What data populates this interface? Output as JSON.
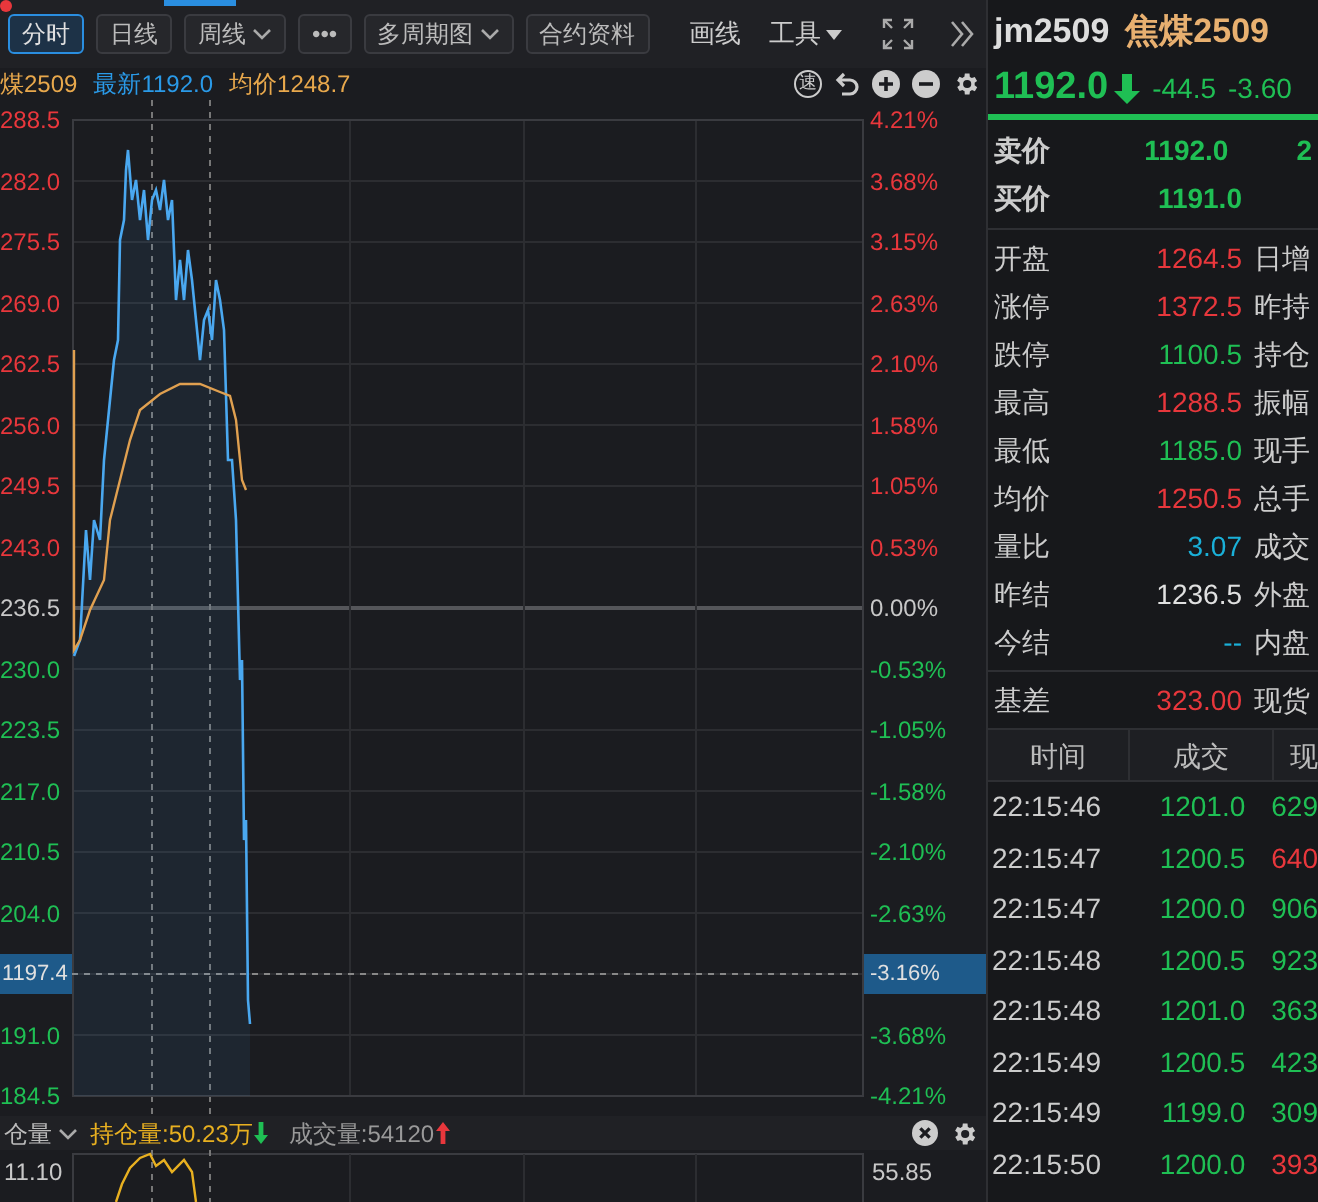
{
  "toolbar": {
    "buttons": [
      {
        "label": "分时",
        "selected": true,
        "dropdown": false
      },
      {
        "label": "日线",
        "selected": false,
        "dropdown": false
      },
      {
        "label": "周线",
        "selected": false,
        "dropdown": true
      },
      {
        "label": "•••",
        "selected": false,
        "dropdown": false
      },
      {
        "label": "多周期图",
        "selected": false,
        "dropdown": true
      },
      {
        "label": "合约资料",
        "selected": false,
        "dropdown": false
      }
    ],
    "actions": [
      {
        "label": "画线",
        "dropdown": false
      },
      {
        "label": "工具",
        "dropdown": true
      }
    ]
  },
  "info_bar": {
    "symbol": "煤2509",
    "latest": "最新1192.0",
    "average": "均价1248.7",
    "badge": "速"
  },
  "chart": {
    "price_axis": [
      {
        "text": "288.5",
        "kind": "tick",
        "color": "#e8373c"
      },
      {
        "text": "282.0",
        "kind": "tick",
        "color": "#e8373c"
      },
      {
        "text": "275.5",
        "kind": "tick",
        "color": "#e8373c"
      },
      {
        "text": "269.0",
        "kind": "tick",
        "color": "#e8373c"
      },
      {
        "text": "262.5",
        "kind": "tick",
        "color": "#e8373c"
      },
      {
        "text": "256.0",
        "kind": "tick",
        "color": "#e8373c"
      },
      {
        "text": "249.5",
        "kind": "tick",
        "color": "#e8373c"
      },
      {
        "text": "243.0",
        "kind": "tick",
        "color": "#e8373c"
      },
      {
        "text": "236.5",
        "kind": "tick",
        "color": "#c8c8c8"
      },
      {
        "text": "230.0",
        "kind": "tick",
        "color": "#1fbf54"
      },
      {
        "text": "223.5",
        "kind": "tick",
        "color": "#1fbf54"
      },
      {
        "text": "217.0",
        "kind": "tick",
        "color": "#1fbf54"
      },
      {
        "text": "210.5",
        "kind": "tick",
        "color": "#1fbf54"
      },
      {
        "text": "204.0",
        "kind": "tick",
        "color": "#1fbf54"
      },
      {
        "text": "1197.4",
        "kind": "cursor"
      },
      {
        "text": "191.0",
        "kind": "tick",
        "color": "#1fbf54"
      },
      {
        "text": "184.5",
        "kind": "tick",
        "color": "#1fbf54"
      }
    ],
    "percent_axis": [
      {
        "text": "4.21%",
        "kind": "tick",
        "color": "#e8373c"
      },
      {
        "text": "3.68%",
        "kind": "tick",
        "color": "#e8373c"
      },
      {
        "text": "3.15%",
        "kind": "tick",
        "color": "#e8373c"
      },
      {
        "text": "2.63%",
        "kind": "tick",
        "color": "#e8373c"
      },
      {
        "text": "2.10%",
        "kind": "tick",
        "color": "#e8373c"
      },
      {
        "text": "1.58%",
        "kind": "tick",
        "color": "#e8373c"
      },
      {
        "text": "1.05%",
        "kind": "tick",
        "color": "#e8373c"
      },
      {
        "text": "0.53%",
        "kind": "tick",
        "color": "#e8373c"
      },
      {
        "text": "0.00%",
        "kind": "tick",
        "color": "#c8c8c8"
      },
      {
        "text": "-0.53%",
        "kind": "tick",
        "color": "#1fbf54"
      },
      {
        "text": "-1.05%",
        "kind": "tick",
        "color": "#1fbf54"
      },
      {
        "text": "-1.58%",
        "kind": "tick",
        "color": "#1fbf54"
      },
      {
        "text": "-2.10%",
        "kind": "tick",
        "color": "#1fbf54"
      },
      {
        "text": "-2.63%",
        "kind": "tick",
        "color": "#1fbf54"
      },
      {
        "text": "-3.16%",
        "kind": "cursor"
      },
      {
        "text": "-3.68%",
        "kind": "tick",
        "color": "#1fbf54"
      },
      {
        "text": "-4.21%",
        "kind": "tick",
        "color": "#1fbf54"
      }
    ]
  },
  "indicator_bar": {
    "selector": "仓量",
    "open_interest": "持仓量:50.23万",
    "oi_rising": false,
    "volume": "成交量:54120",
    "volume_rising": true
  },
  "sub_chart": {
    "left_value": "11.10",
    "right_value": "55.85"
  },
  "quote": {
    "code": "jm2509",
    "name": "焦煤2509",
    "price": "1192.0",
    "rising": false,
    "change": "-44.5",
    "change_pct": "-3.60",
    "bid_ask": [
      {
        "label": "卖价",
        "value": "1192.0",
        "extra": "2"
      },
      {
        "label": "买价",
        "value": "1191.0"
      }
    ],
    "stats": [
      {
        "label": "开盘",
        "value": "1264.5",
        "color": "#e8373c",
        "label2": "日增"
      },
      {
        "label": "涨停",
        "value": "1372.5",
        "color": "#e8373c",
        "label2": "昨持"
      },
      {
        "label": "跌停",
        "value": "1100.5",
        "color": "#1fbf54",
        "label2": "持仓"
      },
      {
        "label": "最高",
        "value": "1288.5",
        "color": "#e8373c",
        "label2": "振幅"
      },
      {
        "label": "最低",
        "value": "1185.0",
        "color": "#1fbf54",
        "label2": "现手"
      },
      {
        "label": "均价",
        "value": "1250.5",
        "color": "#e8373c",
        "label2": "总手"
      },
      {
        "label": "量比",
        "value": "3.07",
        "color": "#1ab0d8",
        "label2": "成交"
      },
      {
        "label": "昨结",
        "value": "1236.5",
        "color": "#e0e0e0",
        "label2": "外盘"
      },
      {
        "label": "今结",
        "value": "--",
        "color": "#1ab0d8",
        "label2": "内盘"
      }
    ],
    "basis": {
      "label": "基差",
      "value": "323.00",
      "color": "#e8373c",
      "label2": "现货"
    }
  },
  "trades": {
    "columns": [
      "时间",
      "成交",
      "现"
    ],
    "rows": [
      {
        "time": "22:15:46",
        "price": "1201.0",
        "volume": "629",
        "color": "#1fbf54"
      },
      {
        "time": "22:15:47",
        "price": "1200.5",
        "volume": "640",
        "color": "#e8373c"
      },
      {
        "time": "22:15:47",
        "price": "1200.0",
        "volume": "906",
        "color": "#1fbf54"
      },
      {
        "time": "22:15:48",
        "price": "1200.5",
        "volume": "923",
        "color": "#1fbf54"
      },
      {
        "time": "22:15:48",
        "price": "1201.0",
        "volume": "363",
        "color": "#1fbf54"
      },
      {
        "time": "22:15:49",
        "price": "1200.5",
        "volume": "423",
        "color": "#1fbf54"
      },
      {
        "time": "22:15:49",
        "price": "1199.0",
        "volume": "309",
        "color": "#1fbf54"
      },
      {
        "time": "22:15:50",
        "price": "1200.0",
        "volume": "393",
        "color": "#e8373c"
      }
    ]
  }
}
